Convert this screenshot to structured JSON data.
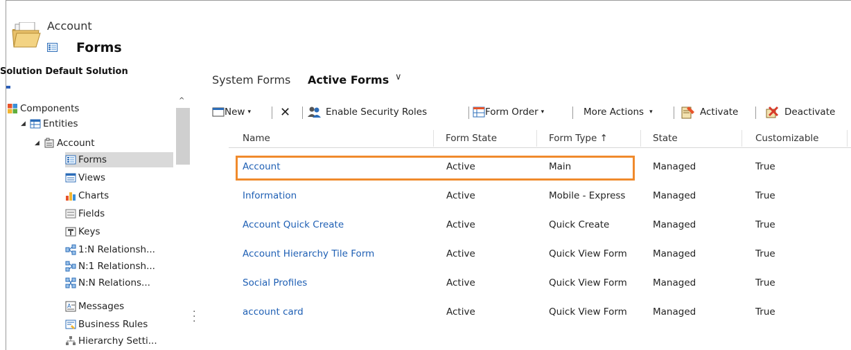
{
  "header": {
    "entity": "Account",
    "title": "Forms"
  },
  "nav": {
    "solution_label": "Solution Default Solution",
    "items": [
      {
        "label": "Components",
        "icon": "components-icon"
      },
      {
        "label": "Entities",
        "icon": "entities-icon"
      },
      {
        "label": "Account",
        "icon": "account-entity-icon"
      },
      {
        "label": "Forms",
        "icon": "forms-icon"
      },
      {
        "label": "Views",
        "icon": "views-icon"
      },
      {
        "label": "Charts",
        "icon": "charts-icon"
      },
      {
        "label": "Fields",
        "icon": "fields-icon"
      },
      {
        "label": "Keys",
        "icon": "keys-icon"
      },
      {
        "label": "1:N Relationsh...",
        "icon": "one-to-many-icon"
      },
      {
        "label": "N:1 Relationsh...",
        "icon": "many-to-one-icon"
      },
      {
        "label": "N:N Relations...",
        "icon": "many-to-many-icon"
      },
      {
        "label": "Messages",
        "icon": "messages-icon"
      },
      {
        "label": "Business Rules",
        "icon": "business-rules-icon"
      },
      {
        "label": "Hierarchy Setti...",
        "icon": "hierarchy-icon"
      }
    ]
  },
  "main": {
    "view_label": "System Forms",
    "view_name": "Active Forms"
  },
  "toolbar": {
    "new": "New",
    "enable_security_roles": "Enable Security Roles",
    "form_order": "Form Order",
    "more_actions": "More Actions",
    "activate": "Activate",
    "deactivate": "Deactivate"
  },
  "grid": {
    "columns": [
      "Name",
      "Form State",
      "Form Type ↑",
      "State",
      "Customizable"
    ],
    "rows": [
      [
        "Account",
        "Active",
        "Main",
        "Managed",
        "True"
      ],
      [
        "Information",
        "Active",
        "Mobile - Express",
        "Managed",
        "True"
      ],
      [
        "Account Quick Create",
        "Active",
        "Quick Create",
        "Managed",
        "True"
      ],
      [
        "Account Hierarchy Tile Form",
        "Active",
        "Quick View Form",
        "Managed",
        "True"
      ],
      [
        "Social Profiles",
        "Active",
        "Quick View Form",
        "Managed",
        "True"
      ],
      [
        "account card",
        "Active",
        "Quick View Form",
        "Managed",
        "True"
      ]
    ]
  },
  "colors": {
    "link": "#1e5fb4",
    "highlight": "#f08a2c",
    "selected_row": "#d9d9d9"
  }
}
